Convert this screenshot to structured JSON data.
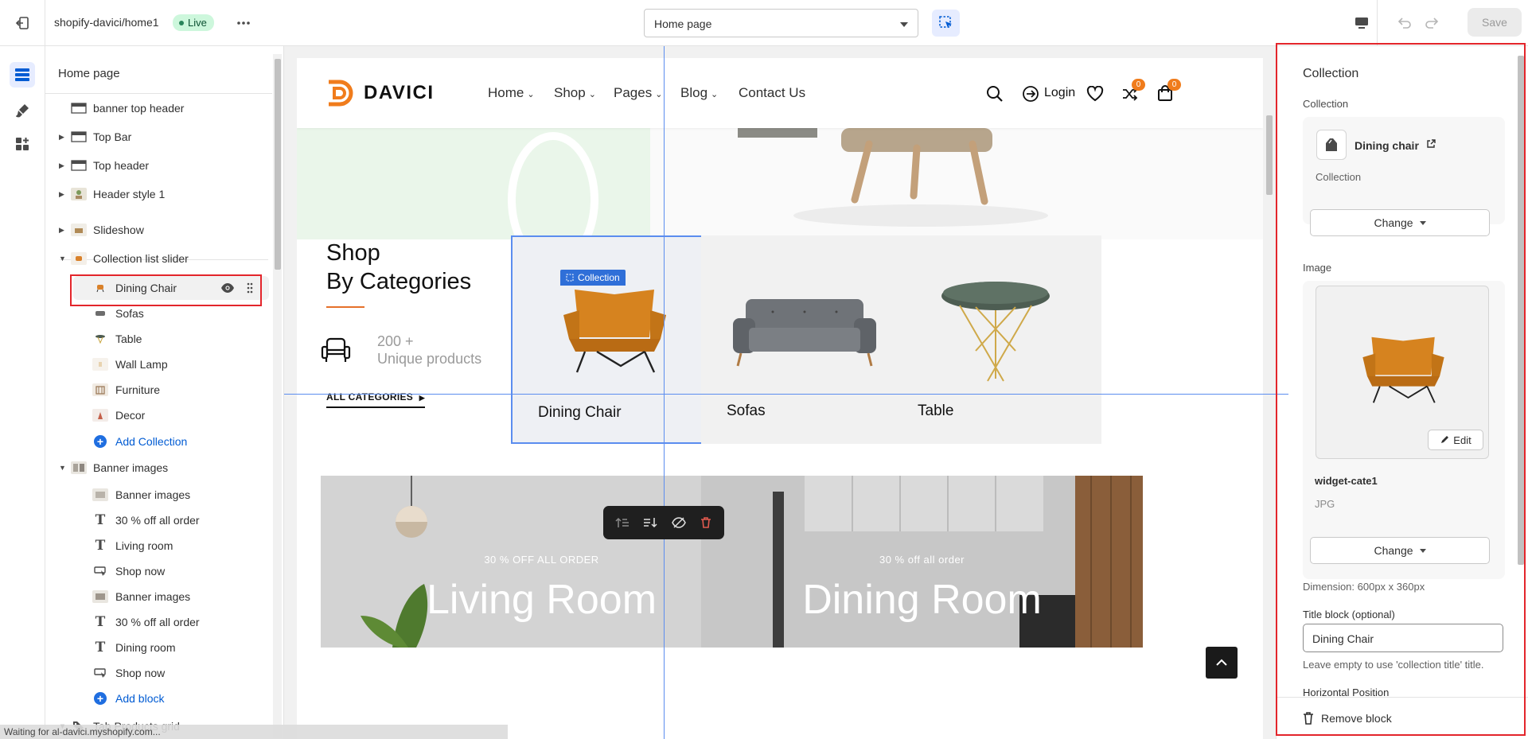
{
  "topbar": {
    "store_name": "shopify-davici/home1",
    "live_badge": "Live",
    "page_select": "Home page",
    "save_label": "Save"
  },
  "sidebar": {
    "title": "Home page",
    "rows": [
      {
        "label": "banner top header"
      },
      {
        "label": "Top Bar"
      },
      {
        "label": "Top header"
      },
      {
        "label": "Header style 1"
      },
      {
        "label": "Slideshow"
      },
      {
        "label": "Collection list slider"
      },
      {
        "label": "Dining Chair"
      },
      {
        "label": "Sofas"
      },
      {
        "label": "Table"
      },
      {
        "label": "Wall Lamp"
      },
      {
        "label": "Furniture"
      },
      {
        "label": "Decor"
      },
      {
        "label": "Add Collection"
      },
      {
        "label": "Banner images"
      },
      {
        "label": "Banner images"
      },
      {
        "label": "30 % off all order"
      },
      {
        "label": "Living room"
      },
      {
        "label": "Shop now"
      },
      {
        "label": "Banner images"
      },
      {
        "label": "30 % off all order"
      },
      {
        "label": "Dining room"
      },
      {
        "label": "Shop now"
      },
      {
        "label": "Add block"
      },
      {
        "label": "Tab Products grid"
      }
    ]
  },
  "store": {
    "logo": "DAVICI",
    "nav": [
      "Home",
      "Shop",
      "Pages",
      "Blog",
      "Contact Us"
    ],
    "login": "Login",
    "wishlist_count": "0",
    "cart_count": "0",
    "shop_title_1": "Shop",
    "shop_title_2": "By Categories",
    "unique_count": "200 +",
    "unique_label": "Unique products",
    "all_categories": "ALL CATEGORIES",
    "selection_tag": "Collection",
    "categories": [
      {
        "name": "Dining Chair"
      },
      {
        "name": "Sofas"
      },
      {
        "name": "Table"
      }
    ],
    "banners": [
      {
        "sub": "30 % OFF ALL ORDER",
        "title": "Living Room"
      },
      {
        "sub": "30 % off all order",
        "title": "Dining Room"
      }
    ]
  },
  "panel": {
    "heading": "Collection",
    "collection_label": "Collection",
    "collection_name": "Dining chair",
    "collection_type": "Collection",
    "change_label": "Change",
    "image_label": "Image",
    "edit_label": "Edit",
    "image_name": "widget-cate1",
    "image_format": "JPG",
    "change_label_2": "Change",
    "dimension": "Dimension: 600px x 360px",
    "title_block_label": "Title block (optional)",
    "title_block_value": "Dining Chair",
    "title_block_hint": "Leave empty to use 'collection title' title.",
    "horizontal_label": "Horizontal Position",
    "remove_label": "Remove block"
  },
  "status_bar": "Waiting for al-davici.myshopify.com...",
  "colors": {
    "accent_blue": "#005bd3",
    "guide_blue": "#5b8def",
    "highlight_red": "#e3252b",
    "brand_orange": "#f07c1c",
    "live_green": "#cdf7dc"
  }
}
